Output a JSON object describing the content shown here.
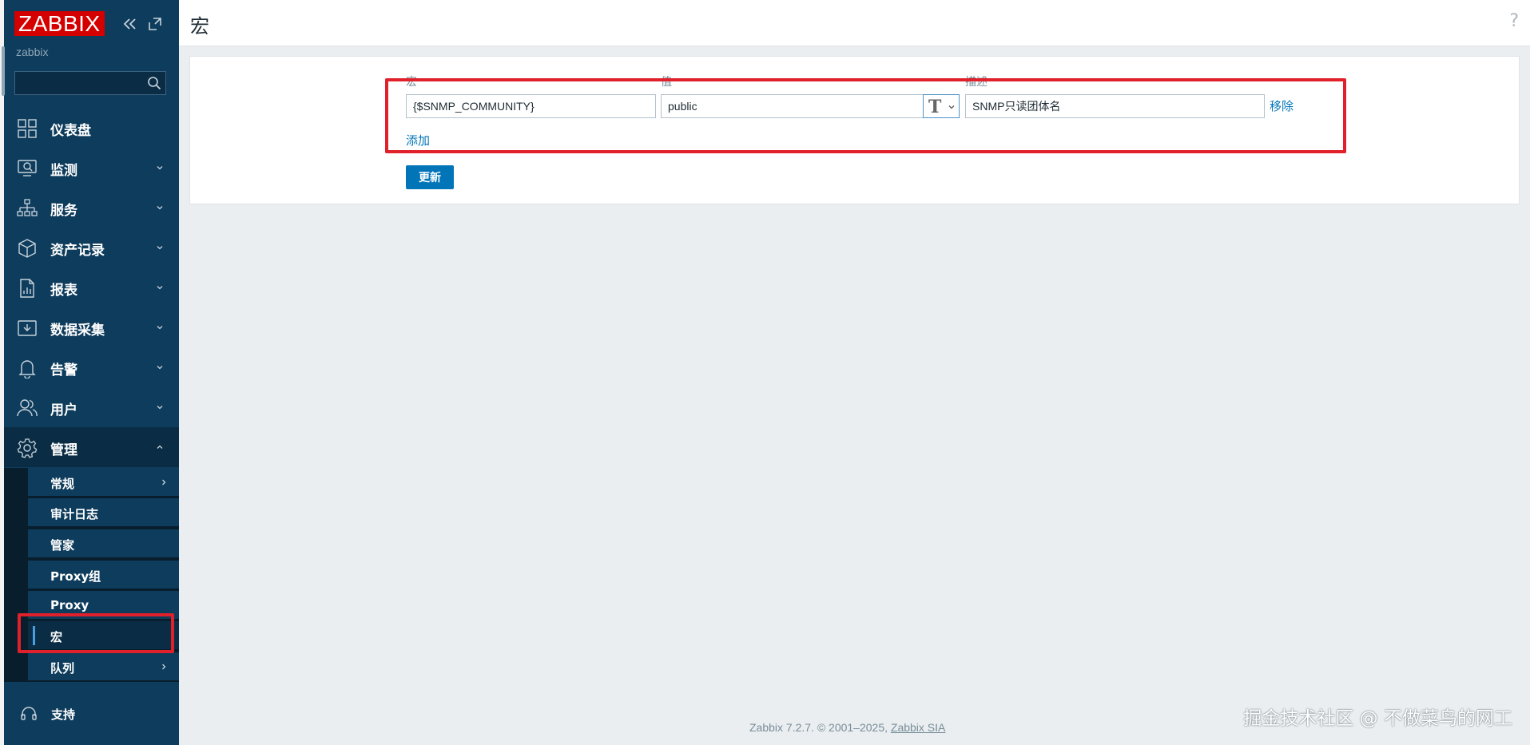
{
  "brand": {
    "logo": "ZABBIX",
    "server_name": "zabbix"
  },
  "search": {
    "value": "",
    "placeholder": ""
  },
  "nav": {
    "items": [
      {
        "label": "仪表盘",
        "icon": "dashboard-icon",
        "has_chevron": false
      },
      {
        "label": "监测",
        "icon": "monitoring-icon",
        "has_chevron": true
      },
      {
        "label": "服务",
        "icon": "services-icon",
        "has_chevron": true
      },
      {
        "label": "资产记录",
        "icon": "inventory-icon",
        "has_chevron": true
      },
      {
        "label": "报表",
        "icon": "reports-icon",
        "has_chevron": true
      },
      {
        "label": "数据采集",
        "icon": "data-collection-icon",
        "has_chevron": true
      },
      {
        "label": "告警",
        "icon": "alerts-icon",
        "has_chevron": true
      },
      {
        "label": "用户",
        "icon": "users-icon",
        "has_chevron": true
      },
      {
        "label": "管理",
        "icon": "administration-icon",
        "has_chevron": true,
        "expanded": true
      }
    ],
    "submenu": [
      {
        "label": "常规",
        "has_chevron": true
      },
      {
        "label": "审计日志",
        "has_chevron": false
      },
      {
        "label": "管家",
        "has_chevron": false
      },
      {
        "label": "Proxy组",
        "has_chevron": false
      },
      {
        "label": "Proxy",
        "has_chevron": false
      },
      {
        "label": "宏",
        "has_chevron": false,
        "selected": true
      },
      {
        "label": "队列",
        "has_chevron": true
      }
    ],
    "support_label": "支持"
  },
  "header": {
    "title": "宏",
    "help": "?"
  },
  "macros": {
    "headers": {
      "macro": "宏",
      "value": "值",
      "description": "描述"
    },
    "rows": [
      {
        "macro": "{$SNMP_COMMUNITY}",
        "value": "public",
        "description": "SNMP只读团体名",
        "remove_label": "移除"
      }
    ],
    "add_label": "添加",
    "update_label": "更新"
  },
  "footer": {
    "text": "Zabbix 7.2.7. © 2001–2025, ",
    "company": "Zabbix SIA"
  },
  "watermark": "掘金技术社区 @ 不做菜鸟的网工",
  "colors": {
    "sidebar": "#0e3c5c",
    "logo_red": "#d40000",
    "link_blue": "#0275b8",
    "highlight_red": "#e0202a"
  }
}
